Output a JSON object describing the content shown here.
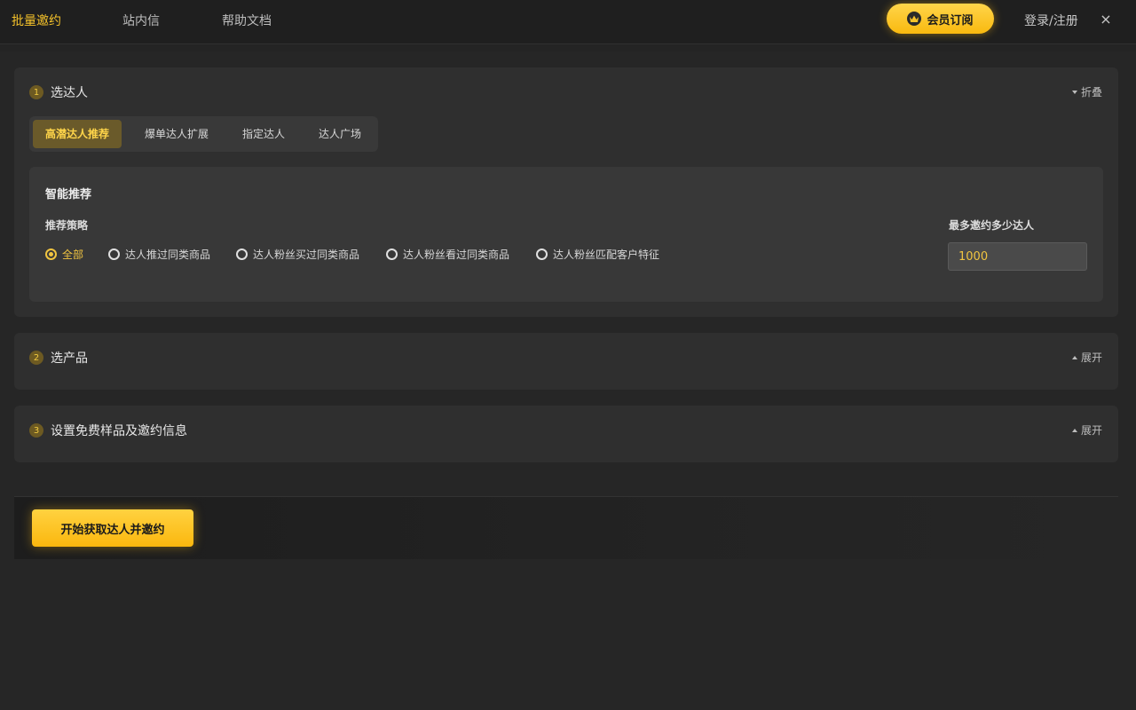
{
  "topbar": {
    "nav": [
      "批量邀约",
      "站内信",
      "帮助文档"
    ],
    "vip_label": "会员订阅",
    "login_label": "登录/注册",
    "close_label": "×"
  },
  "sections": [
    {
      "num": "1",
      "title": "选达人",
      "toggle": "折叠"
    },
    {
      "num": "2",
      "title": "选产品",
      "toggle": "展开"
    },
    {
      "num": "3",
      "title": "设置免费样品及邀约信息",
      "toggle": "展开"
    }
  ],
  "tabs": [
    "高潜达人推荐",
    "爆单达人扩展",
    "指定达人",
    "达人广场"
  ],
  "panel": {
    "title": "智能推荐",
    "strategy_label": "推荐策略",
    "options": [
      "全部",
      "达人推过同类商品",
      "达人粉丝买过同类商品",
      "达人粉丝看过同类商品",
      "达人粉丝匹配客户特征"
    ],
    "selected": "全部",
    "max_label": "最多邀约多少达人",
    "max_value": "1000"
  },
  "action": {
    "start_label": "开始获取达人并邀约"
  },
  "colors": {
    "accent": "#f5c22a",
    "background": "#242424",
    "card": "#2f2f2f"
  }
}
